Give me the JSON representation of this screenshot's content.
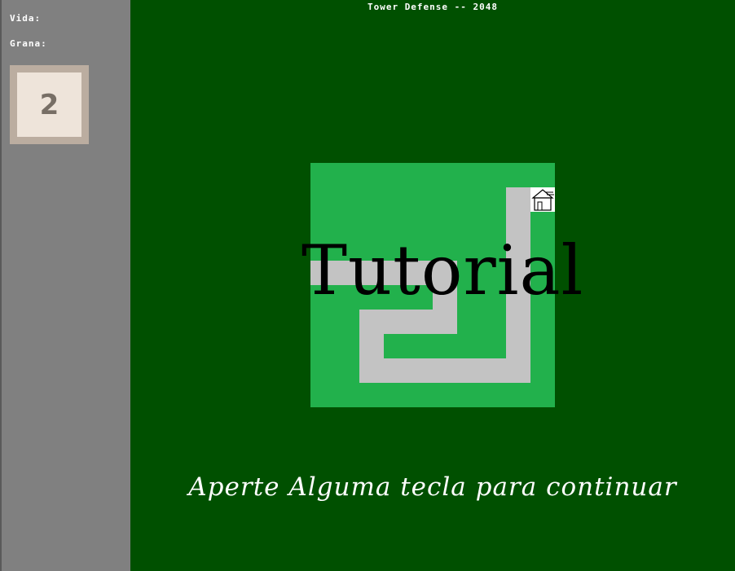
{
  "header": {
    "title": "Tower Defense -- 2048"
  },
  "sidebar": {
    "vida_label": "Vida:",
    "grana_label": "Grana:",
    "tile_value": "2"
  },
  "overlay": {
    "heading": "Tutorial",
    "prompt": "Aperte Alguma tecla para continuar"
  },
  "map": {
    "base_icon": "house-icon"
  },
  "colors": {
    "background": "#005000",
    "sidebar": "#808080",
    "map_grass": "#22b14c",
    "map_path": "#c3c3c3",
    "tile_outer": "#bbada0",
    "tile_inner": "#eee4da",
    "tile_text": "#776e65"
  }
}
